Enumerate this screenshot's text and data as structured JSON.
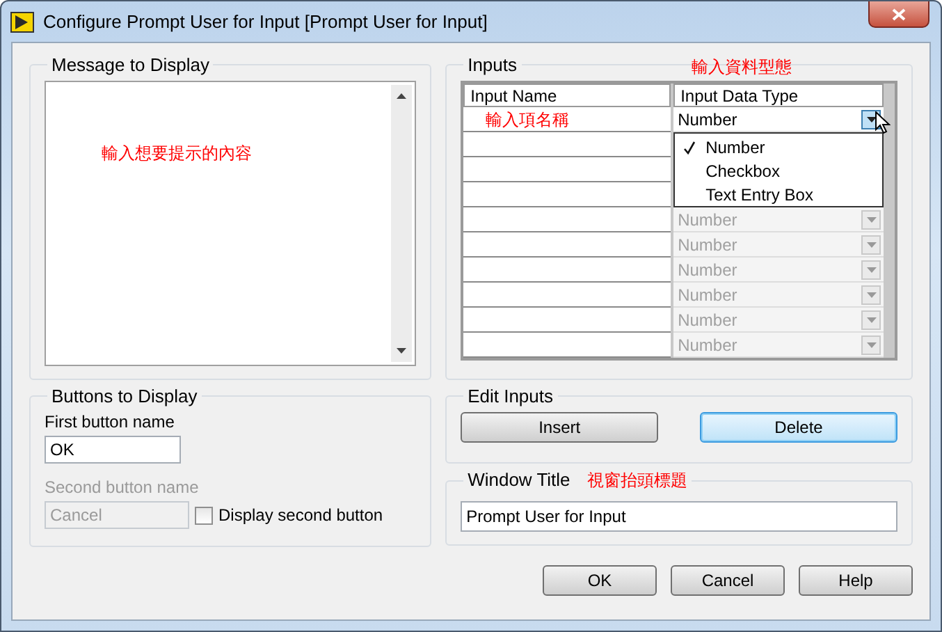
{
  "window": {
    "title": "Configure Prompt User for Input [Prompt User for Input]"
  },
  "message_group": {
    "title": "Message to Display",
    "annotation": "輸入想要提示的內容"
  },
  "buttons_group": {
    "title": "Buttons to Display",
    "first_label": "First button name",
    "first_value": "OK",
    "second_label": "Second button name",
    "second_value": "Cancel",
    "second_disabled": true,
    "display_second": {
      "label": "Display second button",
      "checked": false
    }
  },
  "inputs_group": {
    "title": "Inputs",
    "annotation": "輸入資料型態",
    "columns": [
      "Input Name",
      "Input Data Type"
    ],
    "name_annotation": "輸入項名稱",
    "rows": [
      {
        "type": "Number",
        "enabled": true,
        "open": true
      },
      {},
      {},
      {},
      {
        "type": "Number",
        "enabled": false
      },
      {
        "type": "Number",
        "enabled": false
      },
      {
        "type": "Number",
        "enabled": false
      },
      {
        "type": "Number",
        "enabled": false
      },
      {
        "type": "Number",
        "enabled": false
      },
      {
        "type": "Number",
        "enabled": false
      }
    ],
    "menu_options": [
      {
        "label": "Number",
        "checked": true
      },
      {
        "label": "Checkbox",
        "checked": false
      },
      {
        "label": "Text Entry Box",
        "checked": false
      }
    ]
  },
  "edit_group": {
    "title": "Edit Inputs",
    "buttons": [
      {
        "label": "Insert",
        "focused": false
      },
      {
        "label": "Delete",
        "focused": true
      }
    ]
  },
  "title_group": {
    "title": "Window Title",
    "annotation": "視窗抬頭標題",
    "value": "Prompt User for Input"
  },
  "footer_buttons": [
    "OK",
    "Cancel",
    "Help"
  ]
}
